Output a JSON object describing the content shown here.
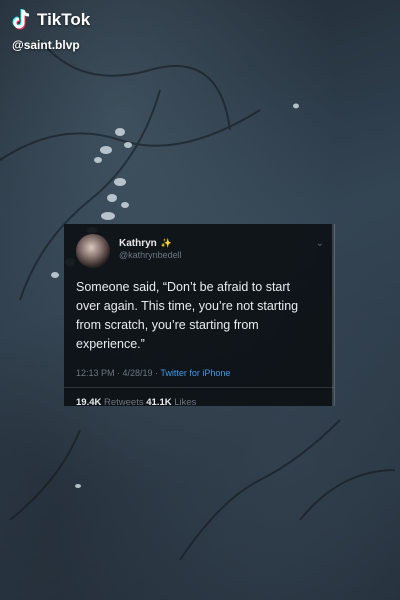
{
  "watermark": {
    "brand": "TikTok",
    "handle": "@saint.blvp",
    "logo_icon": "tiktok-note-icon"
  },
  "tweet": {
    "display_name": "Kathryn",
    "emoji": "✨",
    "username": "@kathrynbedell",
    "text": "Someone said, “Don’t be afraid to start over again. This time, you’re not starting from scratch, you’re starting from experience.”",
    "time": "12:13 PM · 4/28/19 · ",
    "source": "Twitter for iPhone",
    "retweets": "19.4K",
    "retweets_label": " Retweets  ",
    "likes": "41.1K",
    "likes_label": " Likes"
  },
  "colors": {
    "link": "#3f9ae6",
    "card_bg": "#0d1116",
    "text": "#e9ecef",
    "muted": "#6e7780"
  }
}
